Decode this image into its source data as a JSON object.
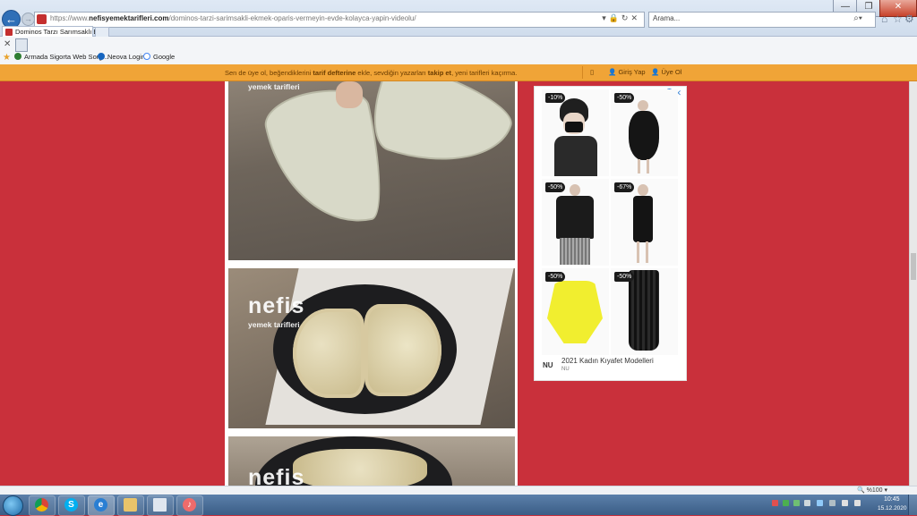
{
  "browser": {
    "url": "https://www.nefisyemektarifleri.com/dominos-tarzi-sarimsakli-ekmek-oparis-vermeyin-evde-kolayca-yapin-videolu/",
    "url_prefix": "https://www.",
    "url_domain": "nefisyemektarifleri.com",
    "url_path": "/dominos-tarzi-sarimsakli-ekmek-oparis-vermeyin-evde-kolayca-yapin-videolu/",
    "search_placeholder": "Arama...",
    "tab_title": "Dominos Tarzı Sarımsaklı E..."
  },
  "favorites": [
    {
      "label": "Armada Sigorta Web Sorg...",
      "color": "#2e7d32"
    },
    {
      "label": "Neova Login",
      "color": "#1565c0"
    },
    {
      "label": "Google",
      "color": "#4285f4"
    }
  ],
  "notification": {
    "part1": "Sen de üye ol, beğendiklerini ",
    "bold1": "tarif defterine",
    "part2": " ekle, sevdiğin yazarları ",
    "bold2": "takip et",
    "part3": ", yeni tarifleri kaçırma.",
    "login": "Giriş Yap",
    "signup": "Üye Ol"
  },
  "watermark": {
    "brand": "nefis",
    "sub": "yemek tarifleri"
  },
  "ad": {
    "products": [
      {
        "discount": "-10%"
      },
      {
        "discount": "-50%"
      },
      {
        "discount": "-50%"
      },
      {
        "discount": "-67%"
      },
      {
        "discount": "-50%"
      },
      {
        "discount": "-50%"
      }
    ],
    "logo": "NU",
    "title": "2021 Kadın Kıyafet Modelleri",
    "brand": "NU"
  },
  "status": {
    "zoom": "%100"
  },
  "clock": {
    "time": "10:45",
    "date": "15.12.2020"
  },
  "colors": {
    "page_bg": "#c9303b",
    "notify_bg": "#f0a437",
    "accent": "#2f6fb7"
  }
}
